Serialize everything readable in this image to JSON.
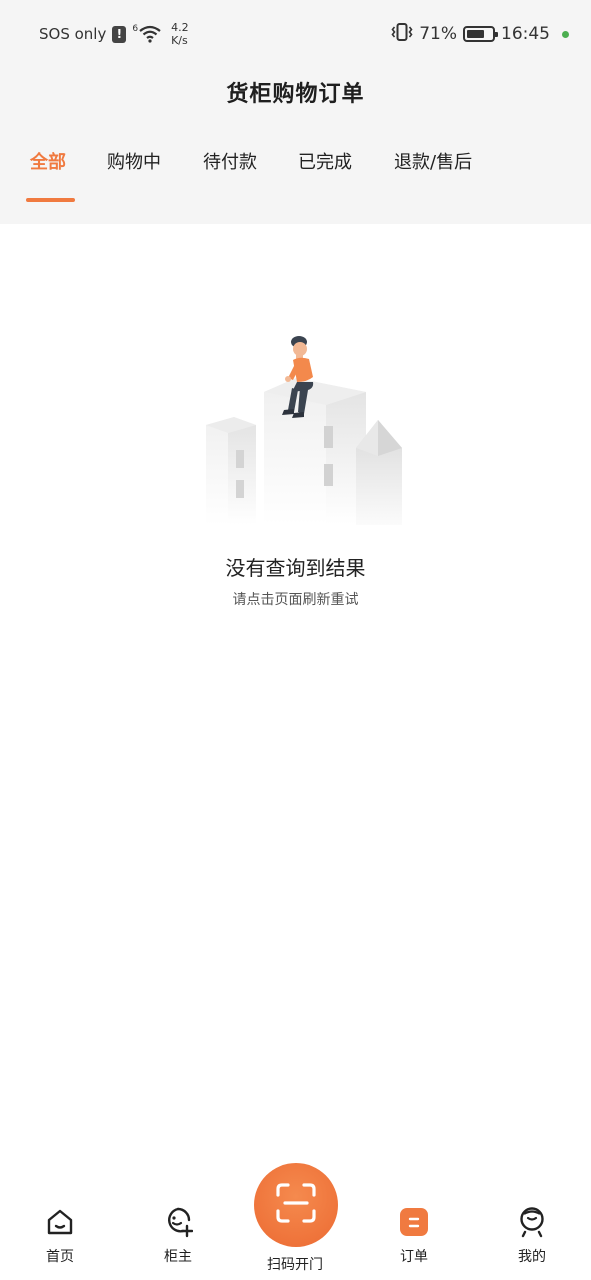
{
  "status_bar": {
    "carrier": "SOS only",
    "alert_badge": "!",
    "network_gen": "6",
    "net_speed_value": "4.2",
    "net_speed_unit": "K/s",
    "battery_percent": "71%",
    "battery_level": 0.71,
    "time": "16:45"
  },
  "header": {
    "title": "货柜购物订单"
  },
  "tabs": [
    {
      "label": "全部",
      "active": true
    },
    {
      "label": "购物中",
      "active": false
    },
    {
      "label": "待付款",
      "active": false
    },
    {
      "label": "已完成",
      "active": false
    },
    {
      "label": "退款/售后",
      "active": false
    }
  ],
  "empty_state": {
    "title": "没有查询到结果",
    "subtitle": "请点击页面刷新重试"
  },
  "bottom_nav": {
    "items": [
      {
        "label": "首页",
        "icon": "home-icon",
        "active": false
      },
      {
        "label": "柜主",
        "icon": "owner-icon",
        "active": false
      },
      {
        "label": "扫码开门",
        "icon": "scan-icon",
        "active": false
      },
      {
        "label": "订单",
        "icon": "order-icon",
        "active": true
      },
      {
        "label": "我的",
        "icon": "profile-icon",
        "active": false
      }
    ]
  },
  "colors": {
    "accent": "#f07a40",
    "header_bg": "#f5f5f5",
    "status_dot": "#4caf50"
  }
}
